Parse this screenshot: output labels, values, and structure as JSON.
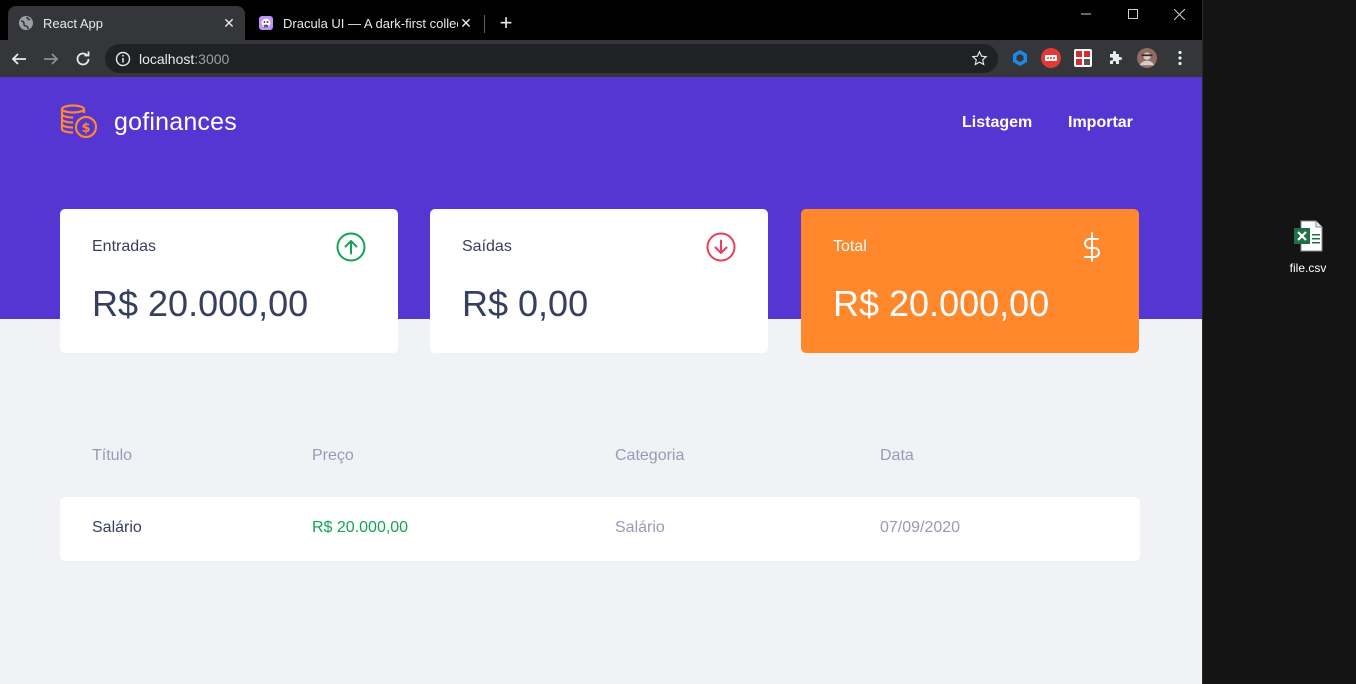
{
  "browser": {
    "tabs": [
      {
        "title": "React App",
        "active": true,
        "favicon": "globe-icon"
      },
      {
        "title": "Dracula UI — A dark-first collection",
        "active": false,
        "favicon": "dracula-icon"
      }
    ],
    "new_tab": "+",
    "window_controls": {
      "minimize": "—",
      "maximize": "☐",
      "close": "✕"
    },
    "url_host": "localhost",
    "url_port": ":3000"
  },
  "app": {
    "logo_text": "gofinances",
    "nav": {
      "list": "Listagem",
      "import": "Importar"
    },
    "cards": {
      "income": {
        "label": "Entradas",
        "value": "R$ 20.000,00"
      },
      "outcome": {
        "label": "Saídas",
        "value": "R$ 0,00"
      },
      "total": {
        "label": "Total",
        "value": "R$ 20.000,00"
      }
    },
    "table": {
      "headers": [
        "Título",
        "Preço",
        "Categoria",
        "Data"
      ],
      "rows": [
        {
          "title": "Salário",
          "price": "R$ 20.000,00",
          "category": "Salário",
          "date": "07/09/2020"
        }
      ]
    }
  },
  "desktop": {
    "file_name": "file.csv"
  },
  "colors": {
    "primary": "#5636d3",
    "secondary": "#ff872c",
    "success": "#12a454",
    "danger": "#e83f5b",
    "text": "#363f5f",
    "text_light": "#969cb3",
    "background": "#f0f2f5"
  }
}
